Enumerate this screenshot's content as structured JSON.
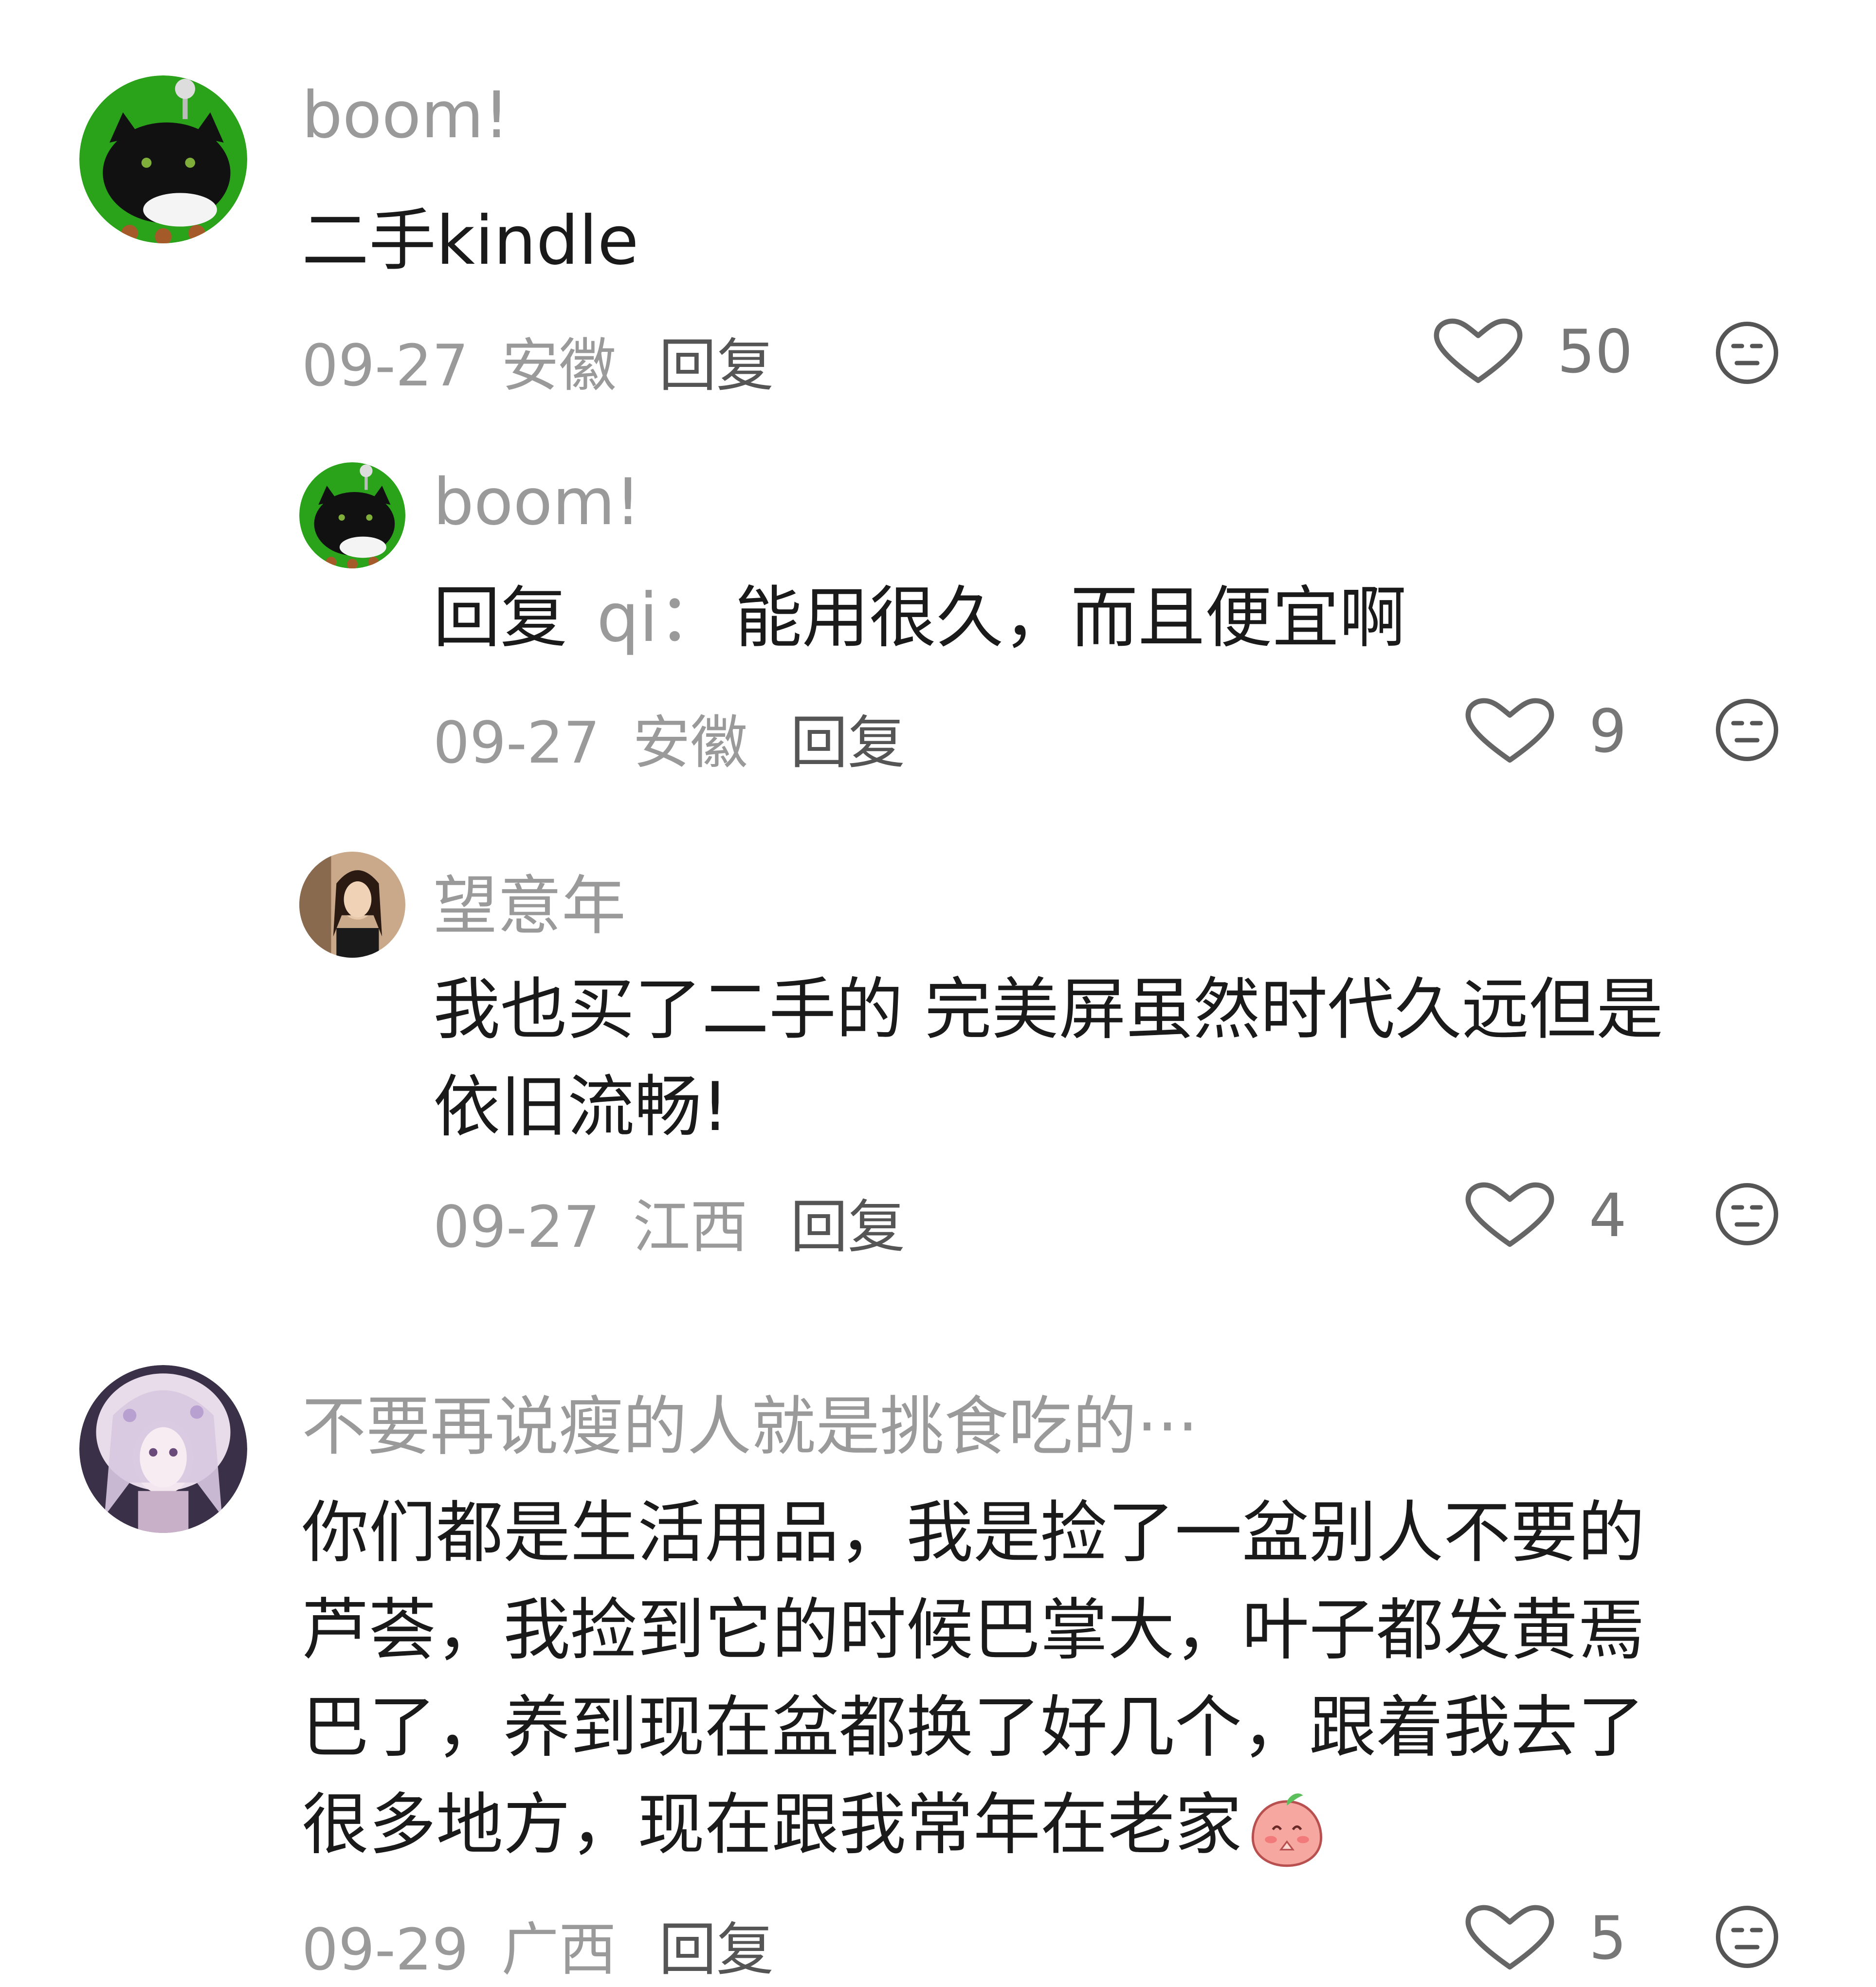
{
  "comments": [
    {
      "username": "boom!",
      "text": "二手kindle",
      "date": "09-27",
      "location": "安徽",
      "reply_label": "回复",
      "likes": "50"
    },
    {
      "username": "boom!",
      "reply_prefix": "回复",
      "reply_target": "qi：",
      "text": "能用很久，而且便宜啊",
      "date": "09-27",
      "location": "安徽",
      "reply_label": "回复",
      "likes": "9"
    },
    {
      "username": "望意年",
      "text_line1": "我也买了二手的 完美屏虽然时代久远但是",
      "text_line2": "依旧流畅!",
      "date": "09-27",
      "location": "江西",
      "reply_label": "回复",
      "likes": "4"
    },
    {
      "username": "不要再说瘦的人就是挑食吃的···",
      "text_line1": "你们都是生活用品，我是捡了一盆别人不要的",
      "text_line2": "芦荟，我捡到它的时候巴掌大，叶子都发黄焉",
      "text_line3": "巴了，养到现在盆都换了好几个，跟着我去了",
      "text_line4": "很多地方，现在跟我常年在老家",
      "date": "09-29",
      "location": "广西",
      "reply_label": "回复",
      "likes": "5"
    }
  ],
  "icons": {
    "like": "heart-outline-icon",
    "dislike": "neutral-face-icon",
    "emoji": "peach-praying-emoji"
  },
  "colors": {
    "text": "#1a1a1a",
    "muted": "#9a9a9a",
    "icon": "#555555"
  }
}
